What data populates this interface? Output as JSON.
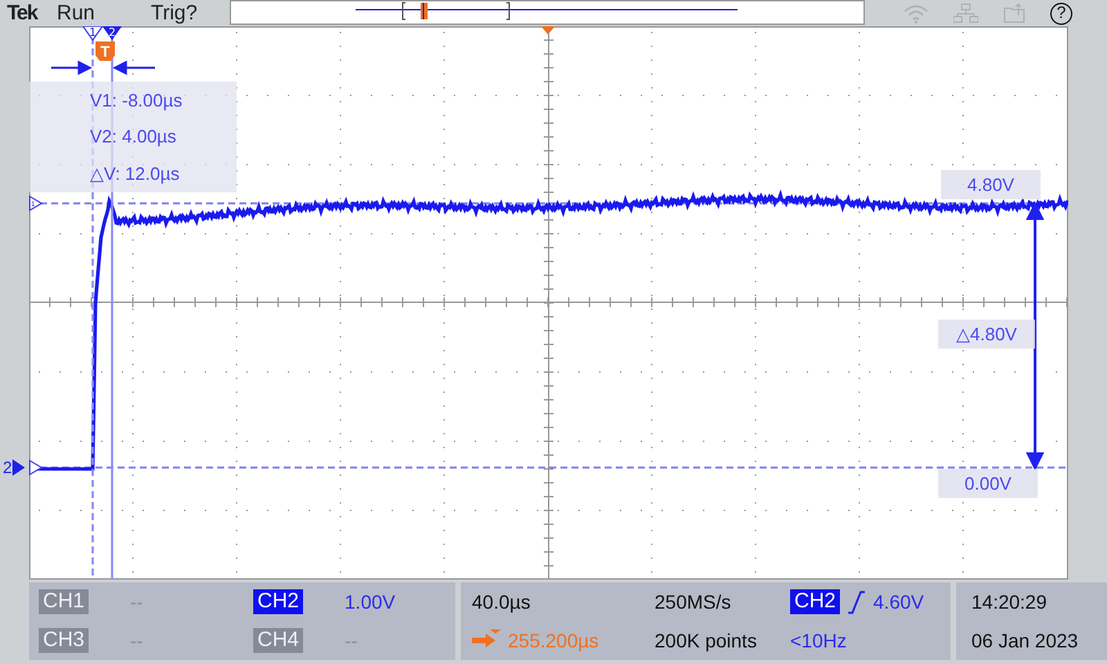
{
  "header": {
    "brand": "Tek",
    "acquisition_state": "Run",
    "trigger_state": "Trig?",
    "help_button": "?"
  },
  "cursors": [
    {
      "flag": "1",
      "kind": "dashed"
    },
    {
      "flag": "2",
      "kind": "solid"
    }
  ],
  "trigger_marker": "T",
  "cursor_readout": [
    "V1: -8.00µs",
    "V2: 4.00µs",
    "△V: 12.0µs"
  ],
  "channel_markers": [
    {
      "label": "1",
      "kind": "hollow"
    },
    {
      "label": "2",
      "kind": "filled"
    }
  ],
  "level_labels": {
    "upper": "4.80V",
    "delta": "△4.80V",
    "lower": "0.00V"
  },
  "channels": [
    {
      "label": "CH1",
      "value": "--",
      "on": false
    },
    {
      "label": "CH2",
      "value": "1.00V",
      "on": true
    },
    {
      "label": "CH3",
      "value": "--",
      "on": false
    },
    {
      "label": "CH4",
      "value": "--",
      "on": false
    }
  ],
  "horizontal": {
    "scale": "40.0µs",
    "position": "255.200µs",
    "sample_rate": "250MS/s",
    "record_length": "200K points"
  },
  "trigger": {
    "source": "CH2",
    "level": "4.60V",
    "frequency": "<10Hz"
  },
  "clock": {
    "time": "14:20:29",
    "date": "06 Jan 2023"
  }
}
